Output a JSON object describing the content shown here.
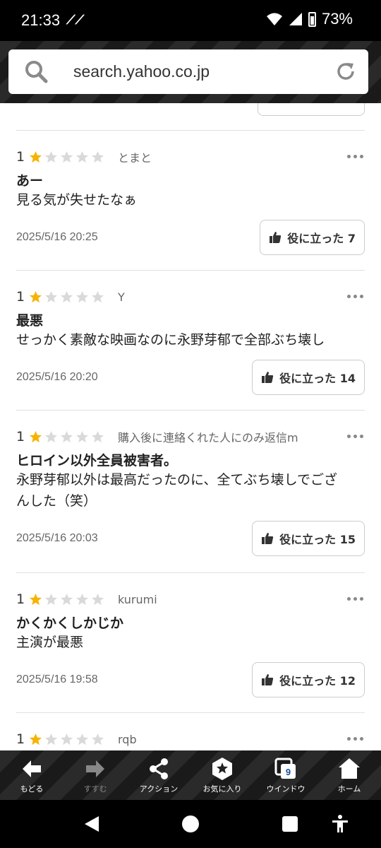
{
  "status": {
    "time": "21:33",
    "battery": "73%"
  },
  "browser": {
    "url": "search.yahoo.co.jp"
  },
  "colors": {
    "star_on": "#f5b400",
    "star_off": "#d9d9d9"
  },
  "reviews": [
    {
      "rating": "1",
      "stars": 1,
      "author": "とまと",
      "title": "あー",
      "body": [
        "見る気が失せたなぁ"
      ],
      "date": "2025/5/16 20:25",
      "helpful": "役に立った 7"
    },
    {
      "rating": "1",
      "stars": 1,
      "author": "Y",
      "title": "最悪",
      "body": [
        "せっかく素敵な映画なのに永野芽郁で全部ぶち壊し"
      ],
      "date": "2025/5/16 20:20",
      "helpful": "役に立った 14"
    },
    {
      "rating": "1",
      "stars": 1,
      "author": "購入後に連絡くれた人にのみ返信m",
      "title": "ヒロイン以外全員被害者。",
      "body": [
        "永野芽郁以外は最高だったのに、全てぶち壊しでござ",
        "んした（笑）"
      ],
      "date": "2025/5/16 20:03",
      "helpful": "役に立った 15"
    },
    {
      "rating": "1",
      "stars": 1,
      "author": "kurumi",
      "title": "かくかくしかじか",
      "body": [
        "主演が最悪"
      ],
      "date": "2025/5/16 19:58",
      "helpful": "役に立った 12"
    },
    {
      "rating": "1",
      "stars": 1,
      "author": "rqb"
    }
  ],
  "toolbar": {
    "back": "もどる",
    "forward": "すすむ",
    "action": "アクション",
    "favorites": "お気に入り",
    "window": "ウインドウ",
    "window_count": "9",
    "home": "ホーム"
  }
}
